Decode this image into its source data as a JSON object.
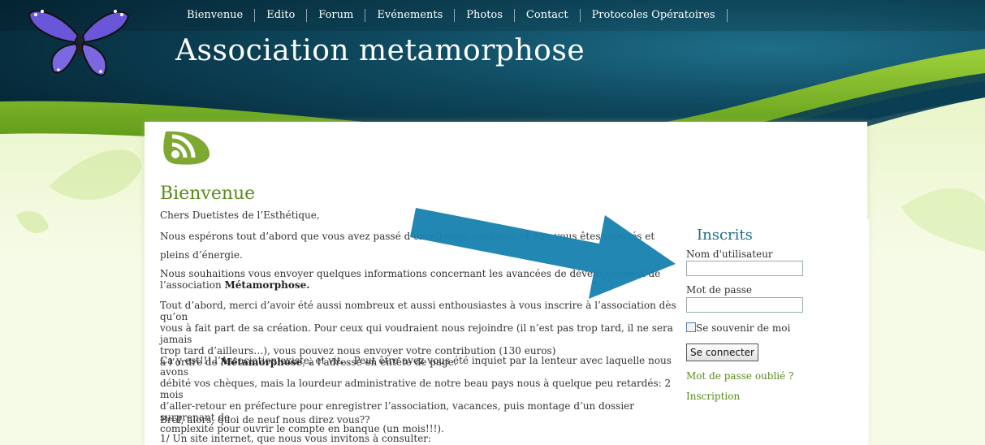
{
  "nav": {
    "items": [
      "Bienvenue",
      "Edito",
      "Forum",
      "Evénements",
      "Photos",
      "Contact",
      "Protocoles Opératoires"
    ]
  },
  "site": {
    "title": "Association metamorphose"
  },
  "main": {
    "heading": "Bienvenue",
    "p1": "Chers Duetistes de l’Esthétique,",
    "p2": "Nous espérons tout d’abord que vous avez passé d’excellentes vacances et que vous êtes reposés et",
    "p3": "pleins d’énergie.",
    "p4a": "Nous souhaitions vous envoyer quelques informations concernant les avancées de développement de",
    "p4b": "l’association ",
    "p4bold": "Métamorphose.",
    "p5a": "Tout d’abord, merci d’avoir été aussi nombreux et aussi enthousiastes à vous inscrire à l’association dès qu’on",
    "p5b": "vous à fait part de sa création. Pour ceux qui voudraient nous rejoindre (il n’est pas trop tard, il ne sera jamais",
    "p5c": "trop tard d’ailleurs…), vous pouvez nous envoyer votre contribution (130 euros)",
    "p5d": "à l’ordre de ",
    "p5bold": "Métamorphose",
    "p5e": ", à l’adresse en entête de page.",
    "p6a": "Ca y est!!! l’Association existe, et vit… Peut être avez vous été inquiet par la lenteur avec laquelle nous avons",
    "p6b": "débité vos chèques, mais la lourdeur administrative de notre beau pays nous à quelque peu retardés: 2 mois",
    "p6c": "d’aller-retour en préfecture pour enregistrer l’association, vacances, puis montage d’un dossier surprenant de",
    "p6d": "complexité pour ouvrir le compte en banque (un mois!!!).",
    "p7": "Bref, alors, quoi de neuf nous direz vous??",
    "p8": "1/ Un site internet, que nous vous invitons à consulter:"
  },
  "sidebar": {
    "title": "Inscrits",
    "username_label": "Nom d'utilisateur",
    "username_value": "",
    "password_label": "Mot de passe",
    "password_value": "",
    "remember_label": "Se souvenir de moi",
    "login_button": "Se connecter",
    "forgot_link": "Mot de passe oublié ?",
    "register_link": "Inscription"
  },
  "colors": {
    "header_dark": "#062a3a",
    "accent_green": "#5b8a1c",
    "title_blue": "#1f6e8a",
    "arrow_blue": "#1a82b0"
  },
  "icons": [
    "butterfly-logo",
    "rss-icon",
    "arrow-annotation"
  ]
}
